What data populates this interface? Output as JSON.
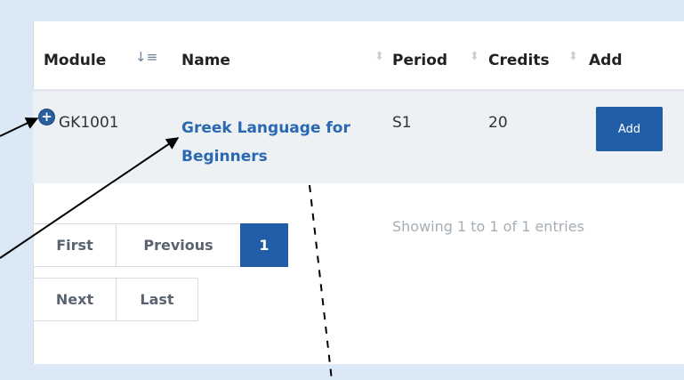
{
  "table": {
    "columns": [
      {
        "label": "Module"
      },
      {
        "label": "Name"
      },
      {
        "label": "Period"
      },
      {
        "label": "Credits"
      },
      {
        "label": "Add"
      }
    ],
    "rows": [
      {
        "module": "GK1001",
        "name": "Greek Language for Beginners",
        "period": "S1",
        "credits": "20",
        "add_label": "Add"
      }
    ]
  },
  "info": "Showing 1 to 1 of 1 entries",
  "pagination": {
    "first": "First",
    "previous": "Previous",
    "current": "1",
    "next": "Next",
    "last": "Last"
  },
  "icons": {
    "expand": "plus-circle-icon",
    "sort_active": "sort-ascending-icon",
    "sort": "sort-both-icon"
  },
  "colors": {
    "frame_background": "#dbe8f5",
    "accent": "#225ea8",
    "link": "#2a69b2",
    "row_background": "#eef1f4"
  }
}
